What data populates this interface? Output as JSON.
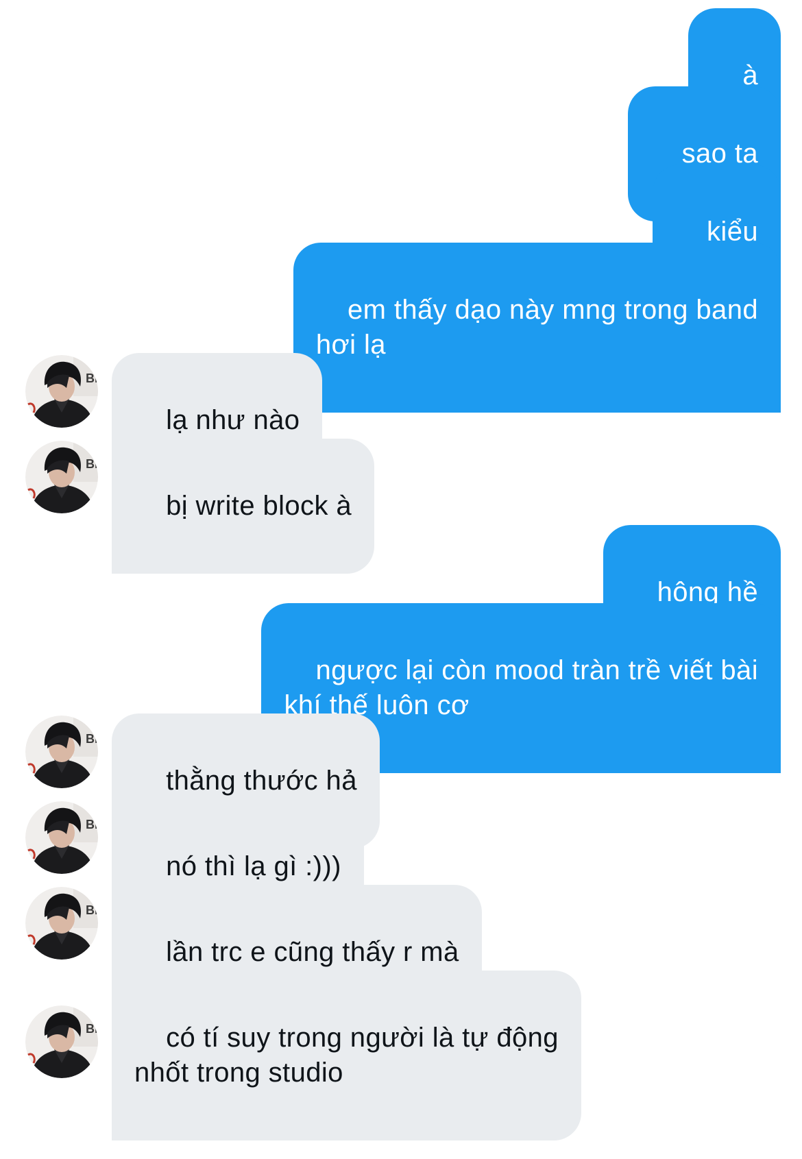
{
  "conversation": {
    "contact_avatar_icon": "contact-avatar-icon",
    "colors": {
      "sent_bubble": "#1d9bf0",
      "received_bubble": "#e9ecef",
      "received_text": "#0f1419",
      "sent_text": "#ffffff"
    },
    "messages": [
      {
        "from": "me",
        "text": "à"
      },
      {
        "from": "me",
        "text": "sao ta"
      },
      {
        "from": "me",
        "text": "kiểu"
      },
      {
        "from": "me",
        "text": "em thấy dạo này mng trong band\nhơi lạ"
      },
      {
        "from": "contact",
        "text": "lạ như nào"
      },
      {
        "from": "contact",
        "text": "bị write block à"
      },
      {
        "from": "me",
        "text": "hông hề"
      },
      {
        "from": "me",
        "text": "ngược lại còn mood tràn trề viết bài\nkhí thế luôn cơ"
      },
      {
        "from": "contact",
        "text": "thằng thước hả"
      },
      {
        "from": "contact",
        "text": "nó thì lạ gì :)))"
      },
      {
        "from": "contact",
        "text": "lần trc e cũng thấy r mà"
      },
      {
        "from": "contact",
        "text": "có tí suy trong người là tự động\nnhốt trong studio"
      }
    ]
  }
}
